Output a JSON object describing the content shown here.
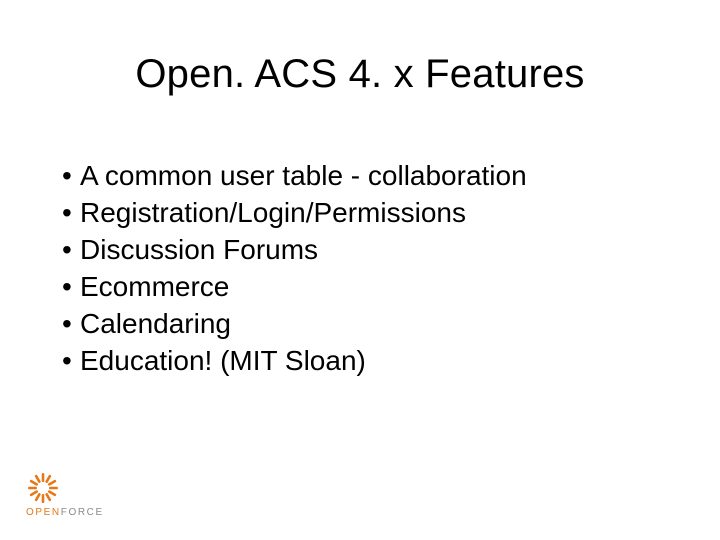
{
  "title": "Open. ACS 4. x Features",
  "bullets": [
    "A common user table - collaboration",
    "Registration/Login/Permissions",
    "Discussion Forums",
    "Ecommerce",
    "Calendaring",
    "Education! (MIT Sloan)"
  ],
  "brand": {
    "open": "OPEN",
    "force": "FORCE",
    "accent_color": "#e67817",
    "muted_color": "#8a8a8a"
  }
}
